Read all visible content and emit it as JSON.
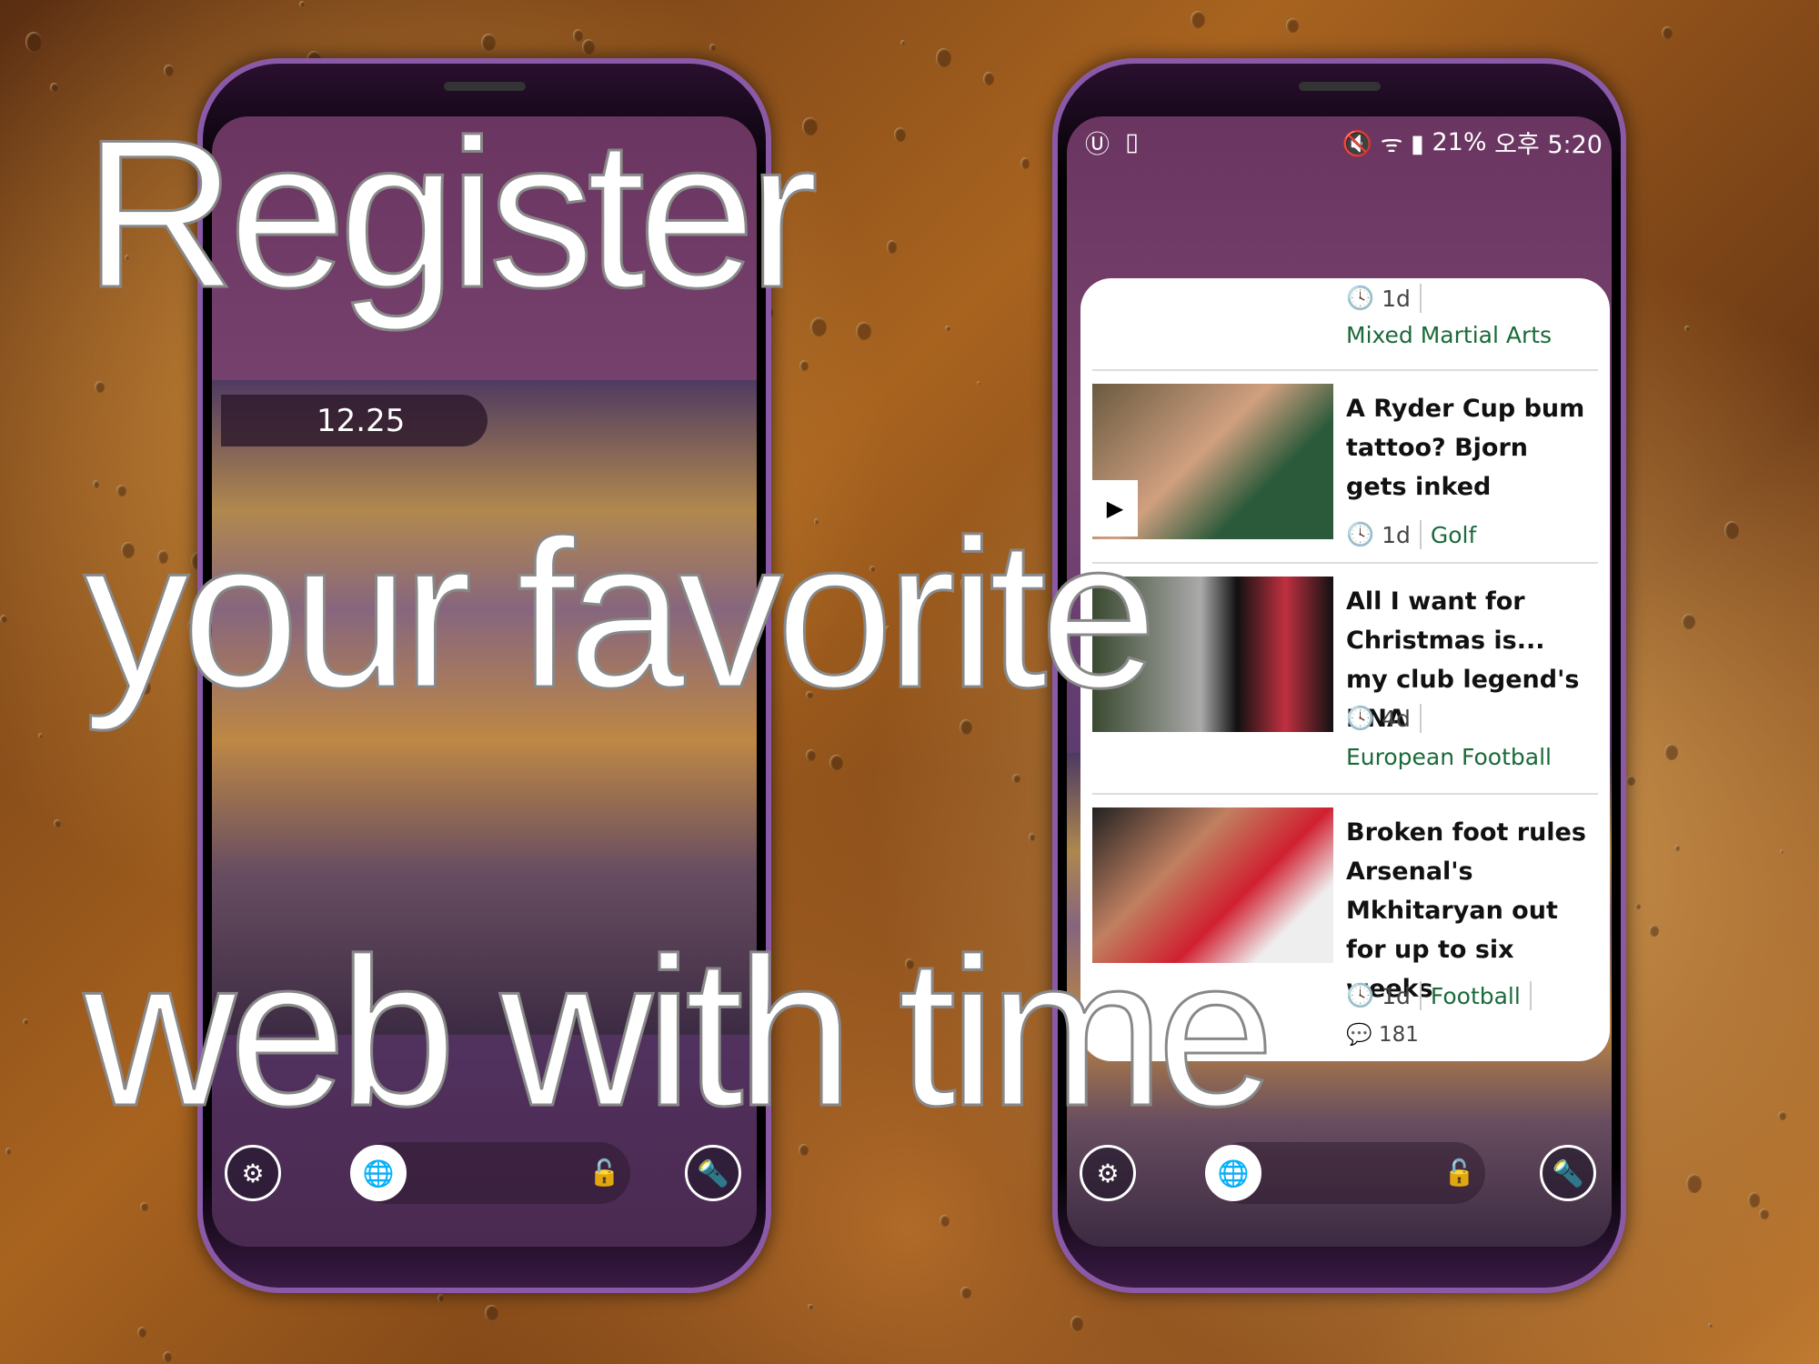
{
  "left_phone": {
    "clock": "12.25",
    "dock": {
      "settings_icon": "phone-settings-icon",
      "globe_icon": "globe-icon",
      "lock_icon": "unlock-icon",
      "flashlight_icon": "flashlight-icon"
    }
  },
  "right_phone": {
    "status_bar": {
      "left_icons": [
        "app-icon",
        "sim-icon"
      ],
      "icons": "🔇 ᯤ ▮",
      "battery": "21%",
      "time": "오후 5:20"
    },
    "news": [
      {
        "time": "1d",
        "category": "Mixed Martial Arts"
      },
      {
        "title": "A Ryder Cup bum tattoo? Bjorn gets inked",
        "time": "1d",
        "category": "Golf",
        "video": true
      },
      {
        "title": "All I want for Christmas is... my club legend's DNA",
        "time": "4d",
        "category": "European Football"
      },
      {
        "title": "Broken foot rules Arsenal's Mkhitaryan out for up to six weeks",
        "time": "1d",
        "category": "Football",
        "comments": "181"
      }
    ]
  },
  "overlay": {
    "line1": "Register",
    "line2": "your favorite",
    "line3": "web with time"
  },
  "colors": {
    "category": "#1a6a3a",
    "phone_frame": "#8a5aa8"
  }
}
